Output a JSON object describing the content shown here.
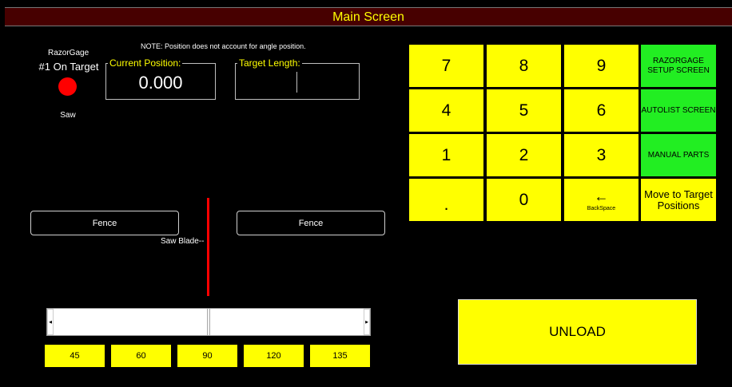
{
  "window": {
    "title": "Main Screen"
  },
  "status": {
    "brand": "RazorGage",
    "target_status": "#1 On Target",
    "indicator_color": "#ff0000",
    "tool_label": "Saw"
  },
  "note": "NOTE: Position does not account for angle position.",
  "current_position": {
    "label": "Current Position:",
    "value": "0.000"
  },
  "target_length": {
    "label": "Target Length:",
    "value": ""
  },
  "keypad": {
    "k7": "7",
    "k8": "8",
    "k9": "9",
    "k4": "4",
    "k5": "5",
    "k6": "6",
    "k1": "1",
    "k2": "2",
    "k3": "3",
    "kdot": ".",
    "k0": "0",
    "backspace_symbol": "←",
    "backspace_label": "BackSpace"
  },
  "side_buttons": {
    "setup": "RAZORGAGE SETUP SCREEN",
    "autolist": "AUTOLIST SCREEN",
    "manual": "MANUAL PARTS",
    "move_target": "Move to Target Positions"
  },
  "diagram": {
    "left_fence": "Fence",
    "right_fence": "Fence",
    "blade_label": "Saw Blade--"
  },
  "angle_slider": {
    "value": 90,
    "min": 45,
    "max": 135
  },
  "angles": [
    "45",
    "60",
    "90",
    "120",
    "135"
  ],
  "unload_label": "UNLOAD",
  "colors": {
    "title_bg": "#470000",
    "title_text": "#ffff00",
    "key_yellow": "#ffff00",
    "key_green": "#22ee22",
    "blade": "#ff0000"
  }
}
